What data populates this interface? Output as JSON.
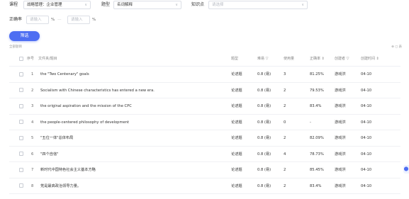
{
  "filters": {
    "course_label": "课程",
    "course_value": "战略管理：企业管理",
    "type_label": "题型",
    "type_value": "名词解释",
    "knowledge_label": "知识点",
    "knowledge_placeholder": "请选择",
    "rate_label": "正确率",
    "rate_min_placeholder": "请输入",
    "rate_max_placeholder": "请输入",
    "percent_sign": "%",
    "dash": "—",
    "filter_button": "筛选"
  },
  "list": {
    "count_text": "全部题目",
    "tools_text": "⊕ ◻ 表"
  },
  "table": {
    "headers": {
      "index": "序号",
      "content": "文件夹/题目",
      "type": "题型",
      "difficulty": "难易 ▽",
      "usage": "使用量",
      "accuracy": "正确率 ⇕",
      "creator": "创建者 ▽",
      "created": "创建时间 ⇕"
    },
    "rows": [
      {
        "index": "1",
        "content": "the \"Two Centenary\" goals",
        "type": "论述题",
        "difficulty": "0.8 (易)",
        "usage": "3",
        "accuracy": "81.25%",
        "creator": "游戏洪",
        "created": "04-10"
      },
      {
        "index": "2",
        "content": "Socialism with Chinese characteristics has entered a new era.",
        "type": "论述题",
        "difficulty": "0.8 (易)",
        "usage": "2",
        "accuracy": "79.53%",
        "creator": "游戏洪",
        "created": "04-10"
      },
      {
        "index": "3",
        "content": "the original aspiration and the mission of the CPC",
        "type": "论述题",
        "difficulty": "0.8 (易)",
        "usage": "2",
        "accuracy": "83.4%",
        "creator": "游戏洪",
        "created": "04-10"
      },
      {
        "index": "4",
        "content": "the people-centered philosophy of development",
        "type": "论述题",
        "difficulty": "0.8 (易)",
        "usage": "0",
        "accuracy": "-",
        "creator": "游戏洪",
        "created": "04-10"
      },
      {
        "index": "5",
        "content": "\"五位一体\"总体布局",
        "type": "论述题",
        "difficulty": "0.8 (易)",
        "usage": "2",
        "accuracy": "82.09%",
        "creator": "游戏洪",
        "created": "04-10"
      },
      {
        "index": "6",
        "content": "\"四个自信\"",
        "type": "论述题",
        "difficulty": "0.8 (易)",
        "usage": "4",
        "accuracy": "78.73%",
        "creator": "游戏洪",
        "created": "04-10"
      },
      {
        "index": "7",
        "content": "新时代中国特色社会主义基本方略",
        "type": "论述题",
        "difficulty": "0.8 (易)",
        "usage": "2",
        "accuracy": "85.45%",
        "creator": "游戏洪",
        "created": "04-10"
      },
      {
        "index": "8",
        "content": "党是最高政治领导力量。",
        "type": "论述题",
        "difficulty": "0.8 (易)",
        "usage": "2",
        "accuracy": "83.4%",
        "creator": "游戏洪",
        "created": "04-10"
      }
    ]
  },
  "icons": {
    "chevron": "chevron-down-icon",
    "side": "side-tool-icon"
  }
}
